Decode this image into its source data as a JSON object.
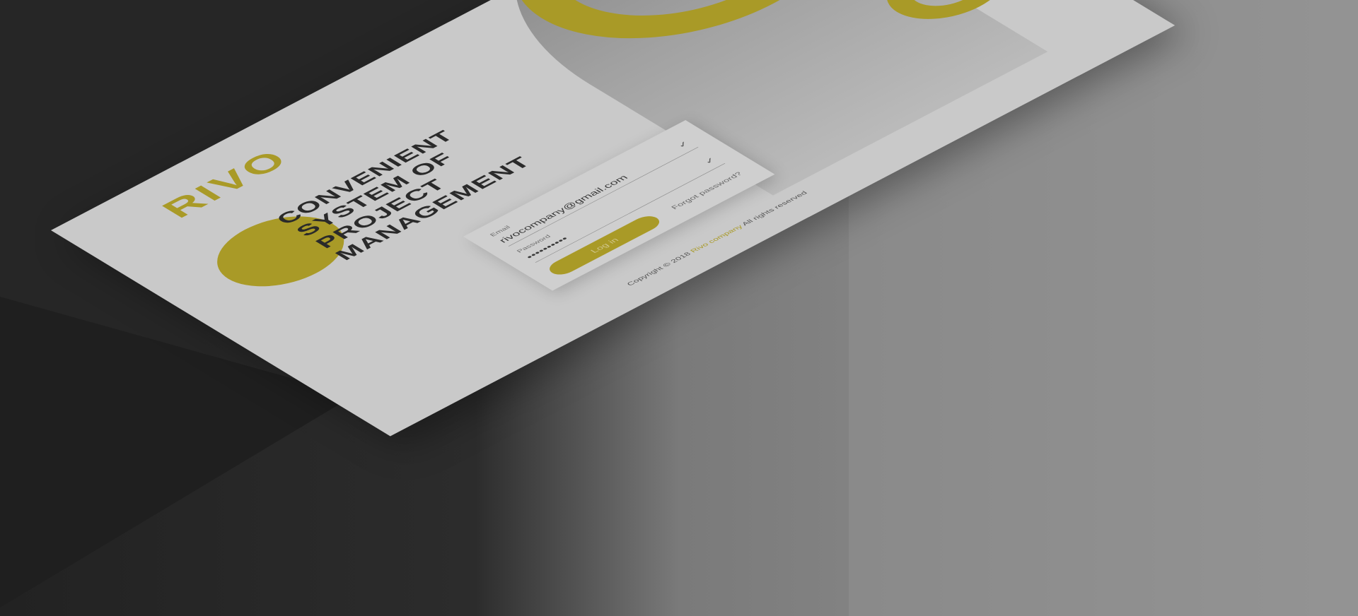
{
  "app": {
    "logo_text": "RIVO",
    "headline": "CONVENIENT SYSTEM OF PROJECT MANAGEMENT"
  },
  "login": {
    "email_label": "Email",
    "email_value": "rivocompany@gmail.com",
    "password_label": "Password",
    "password_value": "••••••••••",
    "login_button": "Log in",
    "forgot_link": "Forgot password?"
  },
  "footer": {
    "prefix": "Copyright © 2018",
    "brand": "Rivo company",
    "suffix": "All rights reserved"
  },
  "colors": {
    "accent": "#a99a27",
    "screen_bg": "#c9c9c9",
    "text_dark": "#2a2a2a"
  },
  "icons": {
    "field_valid": "check-icon"
  }
}
